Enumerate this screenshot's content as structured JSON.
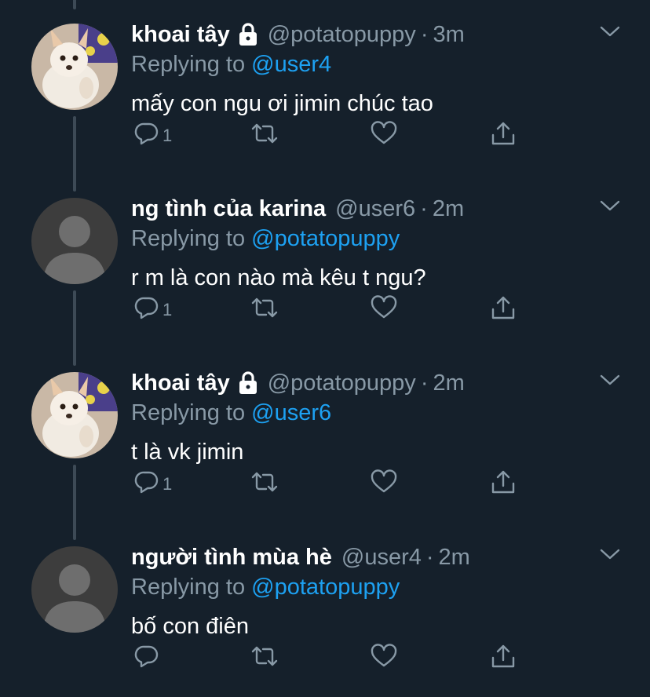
{
  "colors": {
    "background": "#15202b",
    "name": "#ffffff",
    "secondary_text": "#8899a6",
    "mention": "#1da1f2",
    "thread_line": "#3d4a56"
  },
  "tweets": [
    {
      "name": "khoai tây",
      "protected": true,
      "handle": "@potatopuppy",
      "dot": "·",
      "time": "3m",
      "replying_prefix": "Replying to",
      "replying_to": "@user4",
      "text": "mấy con ngu ơi jimin chúc tao",
      "reply_count": "1",
      "avatar": "dog-photo"
    },
    {
      "name": "ng tình của karina",
      "protected": false,
      "handle": "@user6",
      "dot": "·",
      "time": "2m",
      "replying_prefix": "Replying to",
      "replying_to": "@potatopuppy",
      "text": "r m là con nào mà kêu t ngu?",
      "reply_count": "1",
      "avatar": "default-profile"
    },
    {
      "name": "khoai tây",
      "protected": true,
      "handle": "@potatopuppy",
      "dot": "·",
      "time": "2m",
      "replying_prefix": "Replying to",
      "replying_to": "@user6",
      "text": "t là vk jimin",
      "reply_count": "1",
      "avatar": "dog-photo"
    },
    {
      "name": "người tình mùa hè",
      "protected": false,
      "handle": "@user4",
      "dot": "·",
      "time": "2m",
      "replying_prefix": "Replying to",
      "replying_to": "@potatopuppy",
      "text": "bố con điên",
      "reply_count": "",
      "avatar": "default-profile"
    }
  ],
  "icons": {
    "reply": "reply-icon",
    "retweet": "retweet-icon",
    "like": "heart-icon",
    "share": "share-icon",
    "caret": "chevron-down-icon",
    "lock": "lock-icon"
  }
}
